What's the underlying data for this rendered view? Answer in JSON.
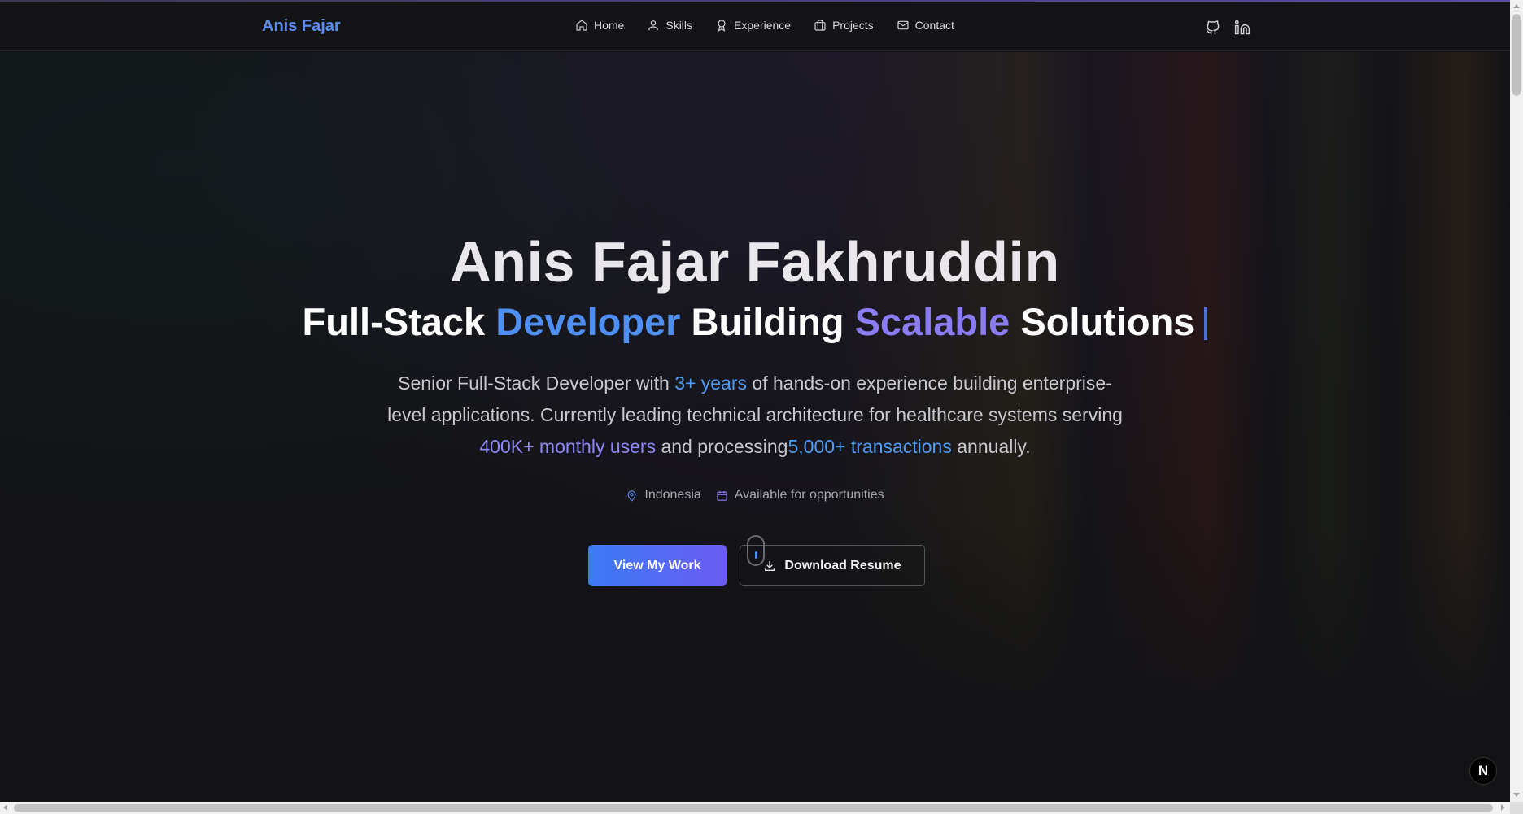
{
  "header": {
    "brand": "Anis Fajar",
    "nav": [
      {
        "label": "Home",
        "icon": "home-icon"
      },
      {
        "label": "Skills",
        "icon": "user-icon"
      },
      {
        "label": "Experience",
        "icon": "award-icon"
      },
      {
        "label": "Projects",
        "icon": "briefcase-icon"
      },
      {
        "label": "Contact",
        "icon": "mail-icon"
      }
    ],
    "social": [
      {
        "icon": "github-icon"
      },
      {
        "icon": "linkedin-icon"
      }
    ]
  },
  "hero": {
    "name": "Anis Fajar Fakhruddin",
    "tagline": {
      "part1": "Full-Stack ",
      "highlight1": "Developer",
      "part2": " Building ",
      "highlight2": "Scalable",
      "part3": " Solutions"
    },
    "description": {
      "t1": "Senior Full-Stack Developer with ",
      "h1": "3+ years",
      "t2": " of hands-on experience building enterprise-level applications. Currently leading technical architecture for healthcare systems serving ",
      "h2": "400K+ monthly users",
      "t3": " and processing",
      "h3": "5,000+ transactions",
      "t4": " annually."
    },
    "location": "Indonesia",
    "availability": "Available for opportunities",
    "primary_button": "View My Work",
    "secondary_button": "Download Resume"
  },
  "badge": {
    "label": "N"
  },
  "colors": {
    "accent_blue": "#4e8ff3",
    "accent_violet": "#8b7cf4",
    "background": "#131316"
  }
}
